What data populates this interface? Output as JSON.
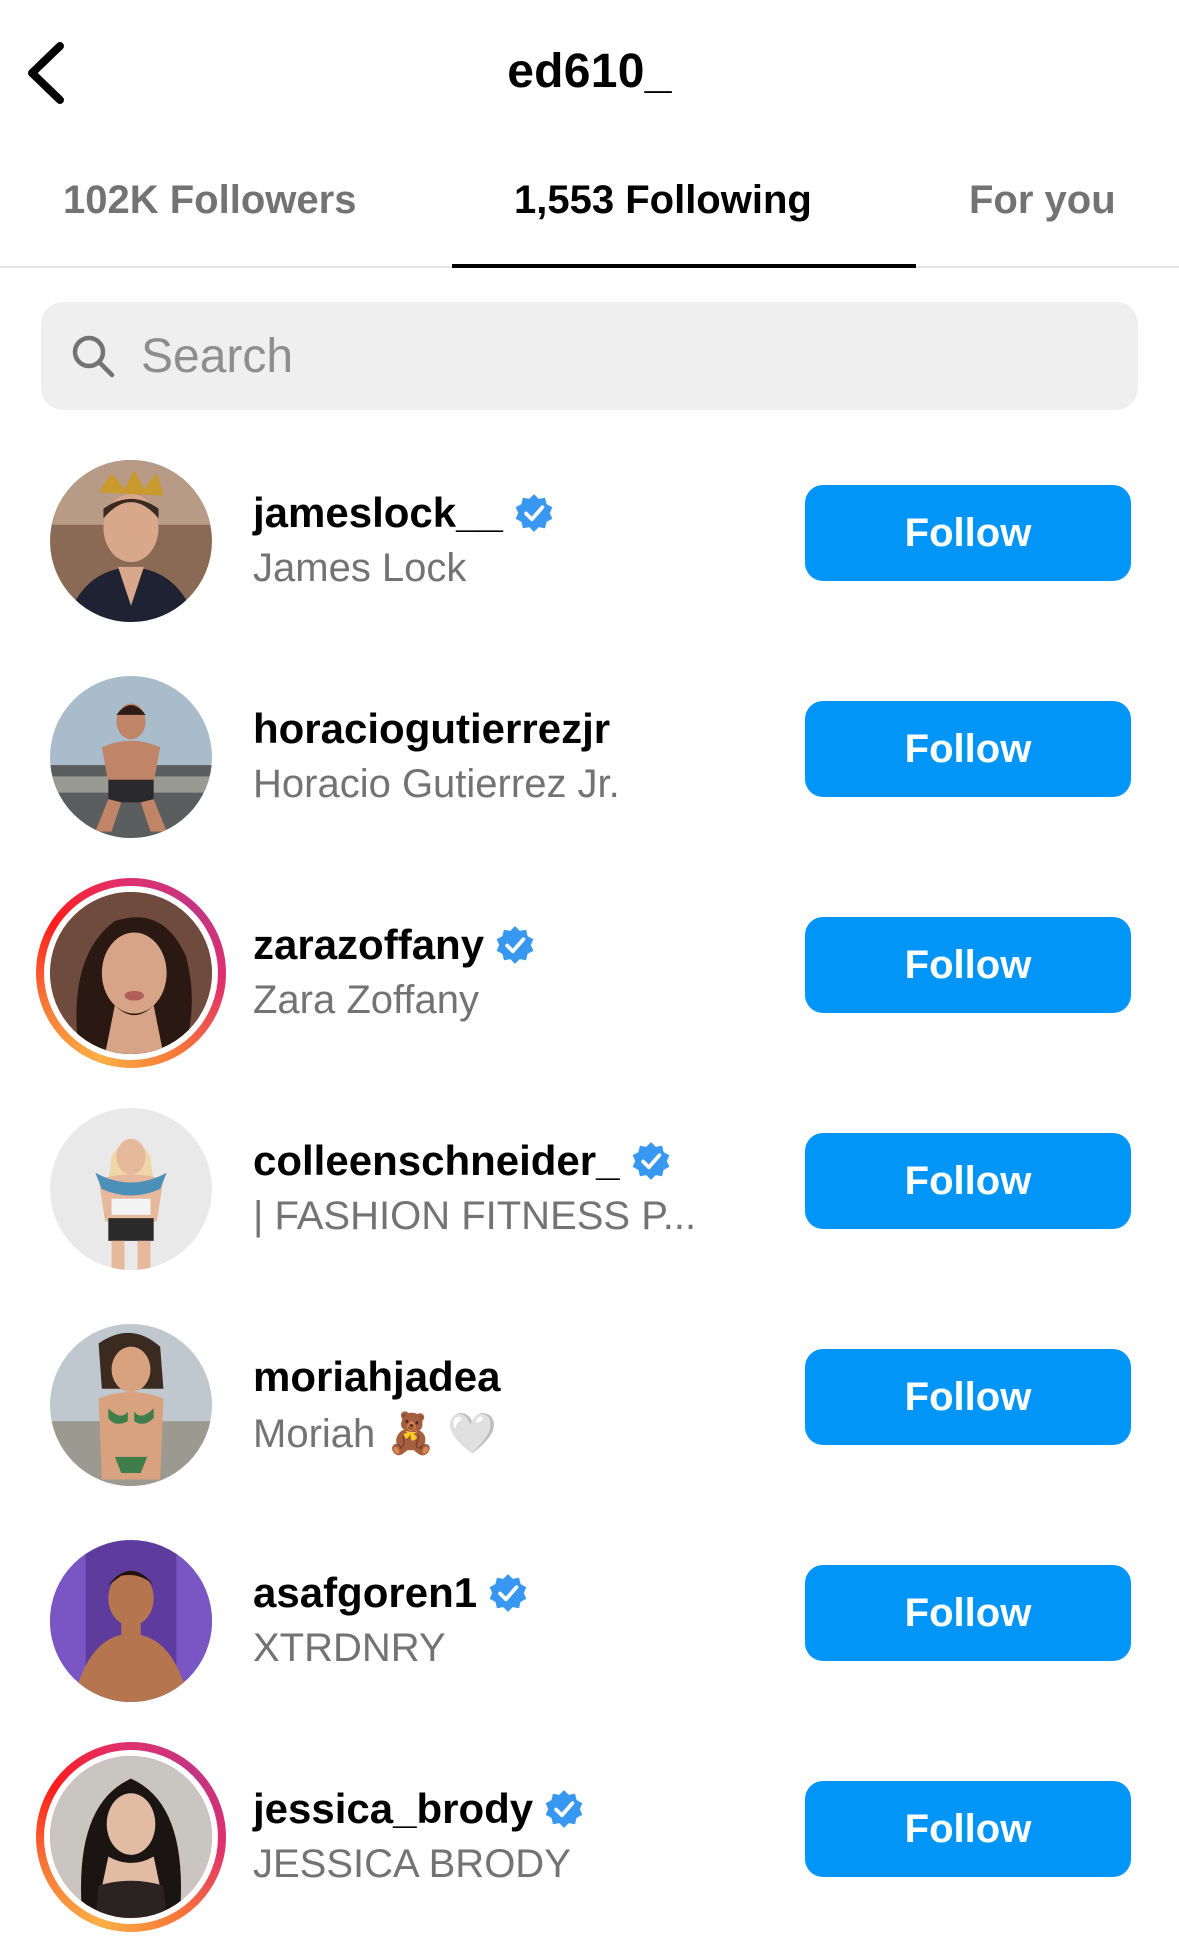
{
  "header": {
    "title": "ed610_",
    "back_icon": "chevron-left-icon"
  },
  "tabs": [
    {
      "label": "102K Followers",
      "active": false
    },
    {
      "label": "1,553 Following",
      "active": true
    },
    {
      "label": "For you",
      "active": false
    }
  ],
  "search": {
    "placeholder": "Search",
    "value": ""
  },
  "accent_color": "#0095f6",
  "users": [
    {
      "username": "jameslock__",
      "fullname": "James Lock",
      "verified": true,
      "story_ring": false,
      "button": "Follow"
    },
    {
      "username": "horaciogutierrezjr",
      "fullname": "Horacio Gutierrez Jr.",
      "verified": false,
      "story_ring": false,
      "button": "Follow"
    },
    {
      "username": "zarazoffany",
      "fullname": "Zara Zoffany",
      "verified": true,
      "story_ring": true,
      "button": "Follow"
    },
    {
      "username": "colleenschneider_",
      "fullname": "| FASHION FITNESS P...",
      "verified": true,
      "story_ring": false,
      "button": "Follow"
    },
    {
      "username": "moriahjadea",
      "fullname": "Moriah 🧸 🤍",
      "verified": false,
      "story_ring": false,
      "button": "Follow"
    },
    {
      "username": "asafgoren1",
      "fullname": "XTRDNRY",
      "verified": true,
      "story_ring": false,
      "button": "Follow"
    },
    {
      "username": "jessica_brody",
      "fullname": "JESSICA BRODY",
      "verified": true,
      "story_ring": true,
      "button": "Follow"
    }
  ]
}
